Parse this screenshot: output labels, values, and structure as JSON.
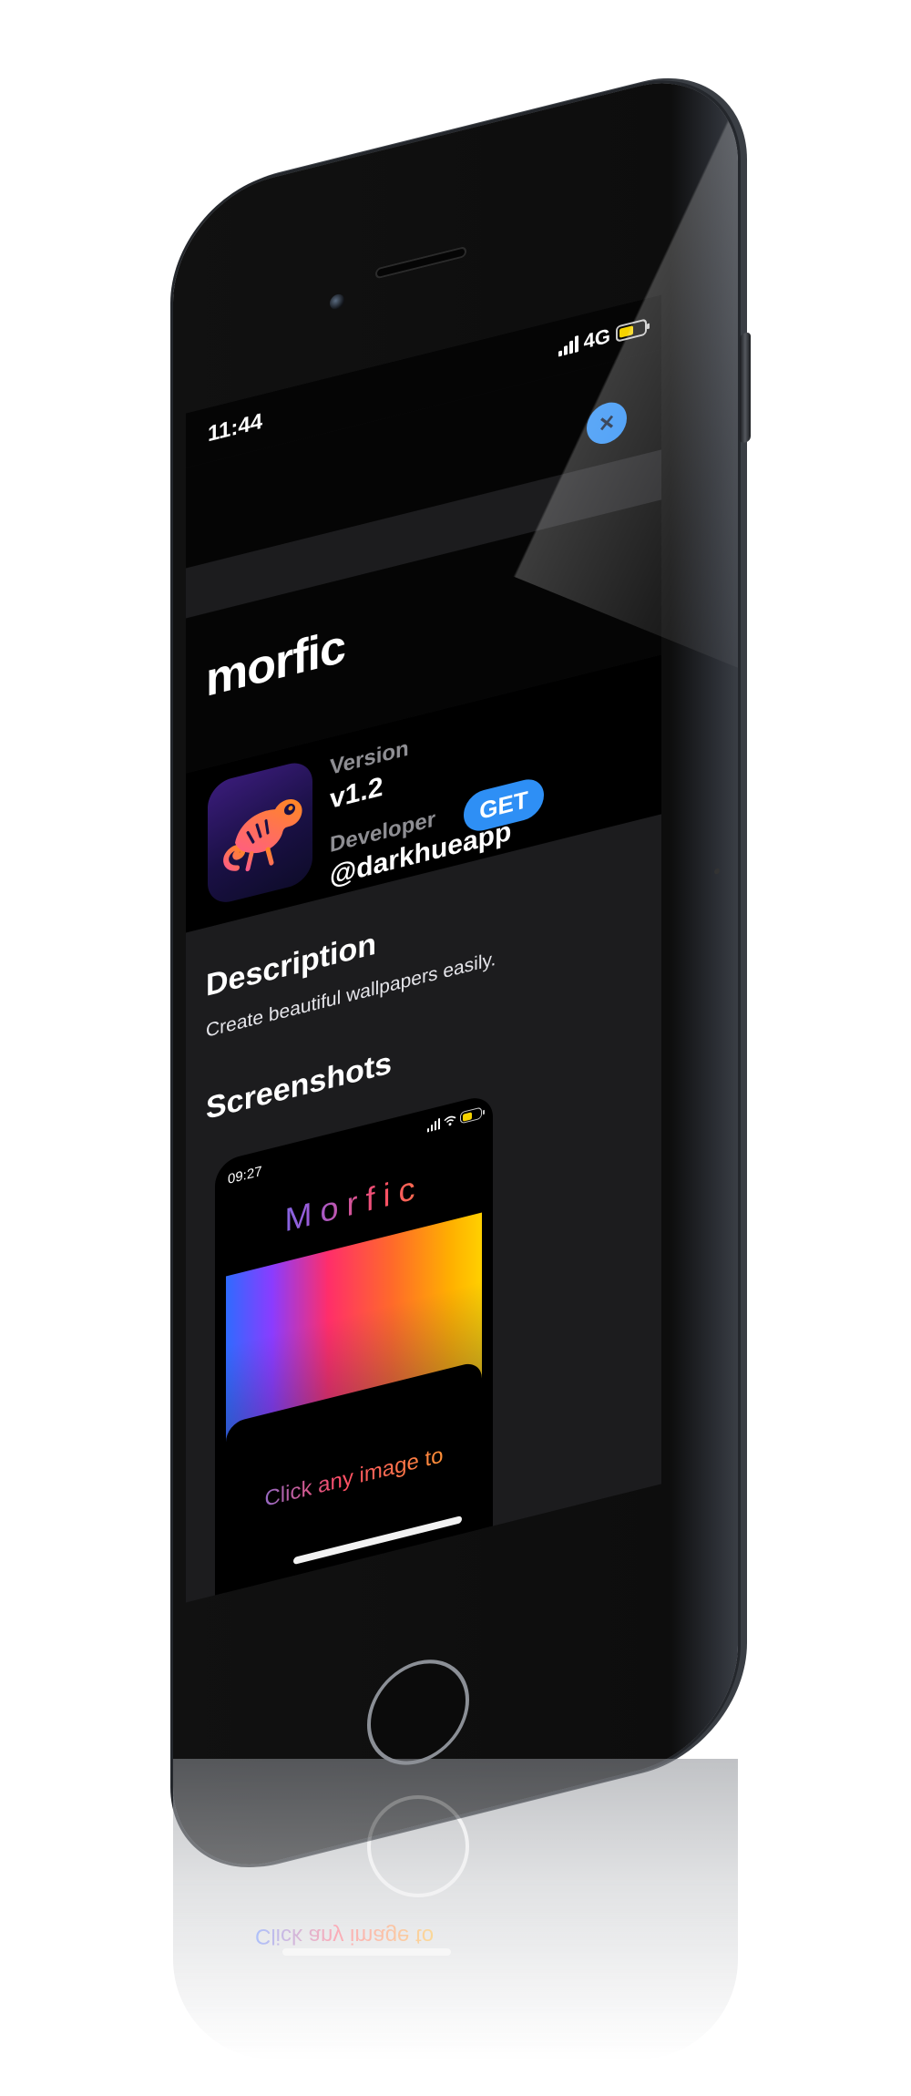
{
  "status_bar": {
    "time": "11:44",
    "network": "4G",
    "signal_icon": "signal-icon",
    "battery_icon": "battery-icon",
    "battery_color": "#f5d300"
  },
  "nav": {
    "close_icon": "close-icon",
    "close_glyph": "×",
    "accent_color": "#2e8ff5"
  },
  "app": {
    "title": "morfic",
    "icon": "chameleon-app-icon",
    "version_label": "Version",
    "version_value": "v1.2",
    "developer_label": "Developer",
    "developer_value": "@darkhueapp",
    "get_label": "GET"
  },
  "description": {
    "heading": "Description",
    "text": "Create beautiful wallpapers easily."
  },
  "screenshots": {
    "heading": "Screenshots",
    "items": [
      {
        "time": "09:27",
        "title": "Morfic",
        "hint": "Click any image to"
      }
    ]
  }
}
